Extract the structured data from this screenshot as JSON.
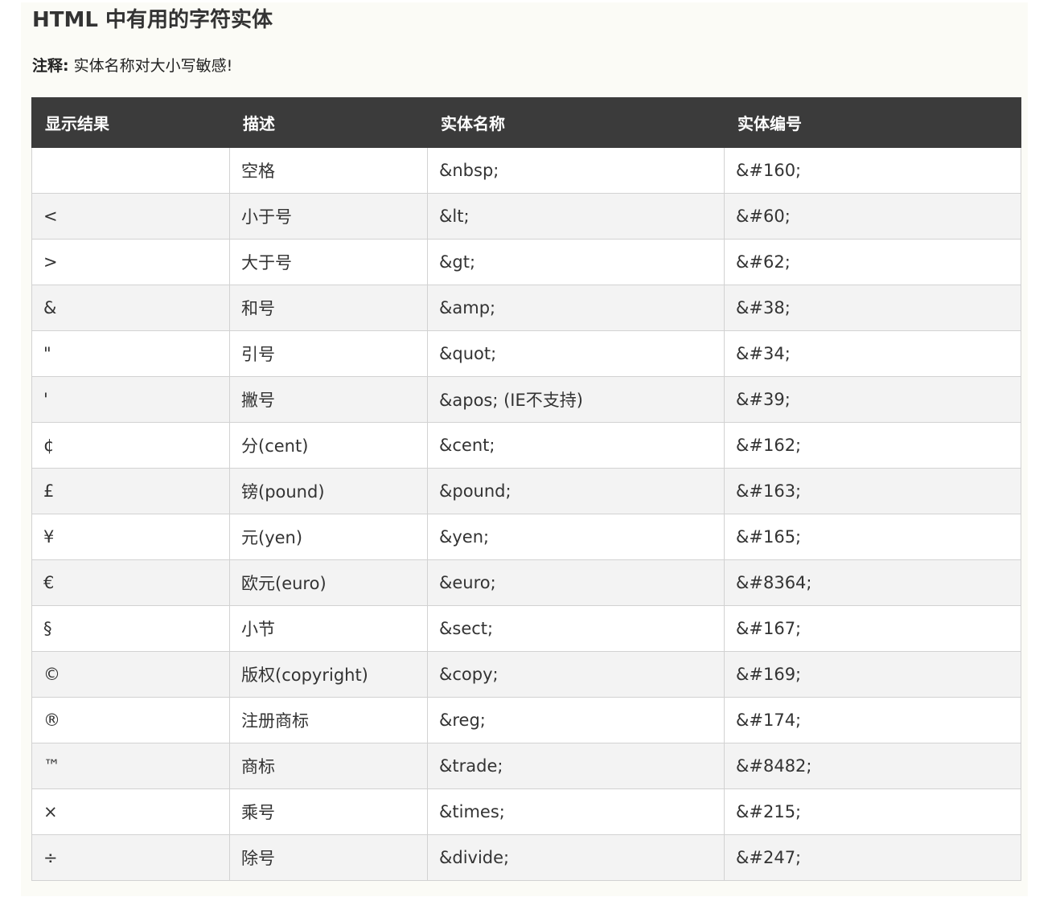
{
  "page": {
    "title": "HTML 中有用的字符实体",
    "note_label": "注释:",
    "note_text": "实体名称对大小写敏感!"
  },
  "table": {
    "headers": [
      "显示结果",
      "描述",
      "实体名称",
      "实体编号"
    ],
    "rows": [
      {
        "result": "",
        "desc": "空格",
        "name": "&nbsp;",
        "number": "&#160;"
      },
      {
        "result": "<",
        "desc": "小于号",
        "name": "&lt;",
        "number": "&#60;"
      },
      {
        "result": ">",
        "desc": "大于号",
        "name": "&gt;",
        "number": "&#62;"
      },
      {
        "result": "&",
        "desc": "和号",
        "name": "&amp;",
        "number": "&#38;"
      },
      {
        "result": "\"",
        "desc": "引号",
        "name": "&quot;",
        "number": "&#34;"
      },
      {
        "result": "'",
        "desc": "撇号",
        "name": "&apos; (IE不支持)",
        "number": "&#39;"
      },
      {
        "result": "¢",
        "desc": "分(cent)",
        "name": "&cent;",
        "number": "&#162;"
      },
      {
        "result": "£",
        "desc": "镑(pound)",
        "name": "&pound;",
        "number": "&#163;"
      },
      {
        "result": "¥",
        "desc": "元(yen)",
        "name": "&yen;",
        "number": "&#165;"
      },
      {
        "result": "€",
        "desc": "欧元(euro)",
        "name": "&euro;",
        "number": "&#8364;"
      },
      {
        "result": "§",
        "desc": "小节",
        "name": "&sect;",
        "number": "&#167;"
      },
      {
        "result": "©",
        "desc": "版权(copyright)",
        "name": "&copy;",
        "number": "&#169;"
      },
      {
        "result": "®",
        "desc": "注册商标",
        "name": "&reg;",
        "number": "&#174;"
      },
      {
        "result": "™",
        "desc": "商标",
        "name": "&trade;",
        "number": "&#8482;"
      },
      {
        "result": "×",
        "desc": "乘号",
        "name": "&times;",
        "number": "&#215;"
      },
      {
        "result": "÷",
        "desc": "除号",
        "name": "&divide;",
        "number": "&#247;"
      }
    ]
  }
}
